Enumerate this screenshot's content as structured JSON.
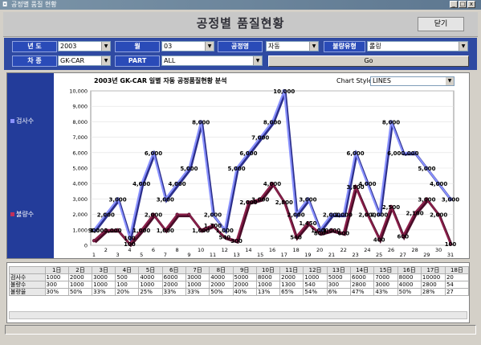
{
  "window": {
    "title": "공정별 품질 현황",
    "min": "_",
    "max": "□",
    "close": "x"
  },
  "header": {
    "title": "공정별 품질현황",
    "close_label": "닫기"
  },
  "filters": {
    "year_label": "년   도",
    "year_value": "2003",
    "month_label": "월",
    "month_value": "03",
    "process_label": "공정명",
    "process_value": "자동",
    "defect_label": "불량유형",
    "defect_value": "롤링",
    "car_label": "차   종",
    "car_value": "GK-CAR",
    "part_label": "PART",
    "part_value": "ALL",
    "go_label": "Go"
  },
  "legend": {
    "inspect": "검사수",
    "defect": "불량수",
    "inspect_color": "#8a92ff",
    "defect_color": "#8a1f4a"
  },
  "chart_style": {
    "label": "Chart Style:",
    "value": "LINES"
  },
  "chart_data": {
    "type": "line",
    "title": "2003년 GK-CAR 일별 자동 공정품질현황 분석",
    "x": [
      "1",
      "2",
      "3",
      "4",
      "5",
      "6",
      "7",
      "8",
      "9",
      "10",
      "11",
      "12",
      "13",
      "14",
      "15",
      "16",
      "17",
      "18",
      "19",
      "20",
      "21",
      "22",
      "23",
      "24",
      "25",
      "26",
      "27",
      "28",
      "29",
      "30",
      "31"
    ],
    "xticks": [
      "1",
      "2",
      "3",
      "4",
      "5",
      "6",
      "7",
      "8",
      "9",
      "10",
      "11",
      "12",
      "13",
      "14",
      "15",
      "16",
      "17",
      "18",
      "19",
      "20",
      "21",
      "22",
      "23",
      "24",
      "25",
      "26",
      "27",
      "28",
      "29",
      "30",
      "31"
    ],
    "ylim": [
      0,
      10000
    ],
    "yticks": [
      "0",
      "1,000",
      "2,000",
      "3,000",
      "4,000",
      "5,000",
      "6,000",
      "7,000",
      "8,000",
      "9,000",
      "10,000"
    ],
    "series": [
      {
        "name": "검사수",
        "color": "#8a92ff",
        "values": [
          1000,
          2000,
          3000,
          500,
          4000,
          6000,
          3000,
          4000,
          5000,
          8000,
          2000,
          1000,
          5000,
          6000,
          7000,
          8000,
          10000,
          2000,
          3000,
          1000,
          2000,
          2000,
          6000,
          4000,
          2000,
          8000,
          6000,
          6000,
          5000,
          4000,
          3000
        ]
      },
      {
        "name": "불량수",
        "color": "#8a1f4a",
        "values": [
          300,
          1000,
          1000,
          100,
          1000,
          2000,
          1000,
          2000,
          2000,
          1000,
          1300,
          540,
          300,
          2800,
          3000,
          4000,
          2800,
          540,
          1450,
          800,
          1000,
          800,
          3800,
          2000,
          400,
          2500,
          600,
          2100,
          3000,
          2000,
          100
        ]
      }
    ],
    "labels_inspect": [
      "900",
      "2,000",
      "3,000",
      "100",
      "4,000",
      "6,000",
      "3,000",
      "4,000",
      "5,000",
      "8,000",
      "2,000",
      "1,000",
      "5,000",
      "6,000",
      "7,000",
      "8,000",
      "10,000",
      "2,000",
      "3,000",
      "1,000",
      "2,000",
      "2,000",
      "6,000",
      "4,000",
      "2,000",
      "8,000",
      "6,000,000",
      "",
      "5,000",
      "4,000",
      "3,000"
    ],
    "labels_defect": [
      "",
      "1,000,000",
      "",
      "100",
      "1,000",
      "2,000",
      "1,000",
      "",
      "",
      "1,000",
      "1,300",
      "540",
      "300",
      "2,000",
      "3,000",
      "4,000",
      "2,800",
      "540",
      "1,450",
      "800",
      "1,000",
      "600",
      "3,800",
      "2,000",
      "400",
      "2,500",
      "600",
      "2,100",
      "3,000",
      "2,000",
      "100"
    ]
  },
  "grid": {
    "headers": [
      "1日",
      "2日",
      "3日",
      "4日",
      "5日",
      "6日",
      "7日",
      "8日",
      "9日",
      "10日",
      "11日",
      "12日",
      "13日",
      "14日",
      "15日",
      "16日",
      "17日",
      "18日"
    ],
    "rows": [
      {
        "label": "검사수",
        "cells": [
          "1000",
          "2000",
          "3000",
          "500",
          "4000",
          "6000",
          "3000",
          "4000",
          "5000",
          "8000",
          "2000",
          "1000",
          "5000",
          "6000",
          "7000",
          "8000",
          "10000",
          "20"
        ]
      },
      {
        "label": "불량수",
        "cells": [
          "300",
          "1000",
          "1000",
          "100",
          "1000",
          "2000",
          "1000",
          "2000",
          "2000",
          "1000",
          "1300",
          "540",
          "300",
          "2800",
          "3000",
          "4000",
          "2800",
          "54"
        ]
      },
      {
        "label": "불량율",
        "cells": [
          "30%",
          "50%",
          "33%",
          "20%",
          "25%",
          "33%",
          "33%",
          "50%",
          "40%",
          "13%",
          "65%",
          "54%",
          "6%",
          "47%",
          "43%",
          "50%",
          "28%",
          "27"
        ]
      }
    ]
  }
}
